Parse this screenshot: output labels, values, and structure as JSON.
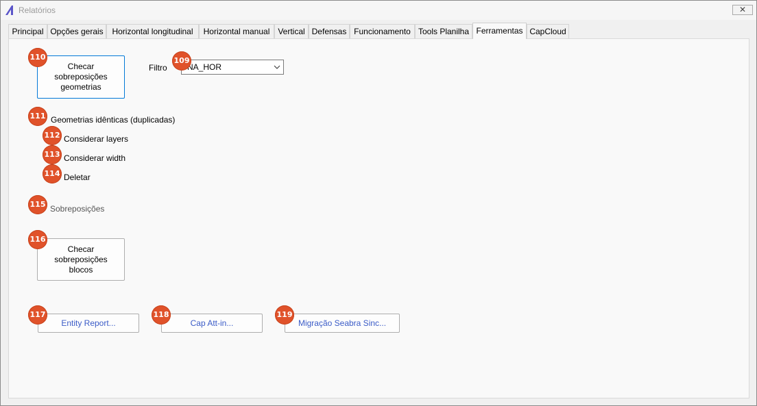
{
  "window": {
    "title": "Relatórios",
    "close_glyph": "✕"
  },
  "tabs": [
    {
      "label": "Principal"
    },
    {
      "label": "Opções gerais"
    },
    {
      "label": "Horizontal longitudinal"
    },
    {
      "label": "Horizontal manual"
    },
    {
      "label": "Vertical"
    },
    {
      "label": "Defensas"
    },
    {
      "label": "Funcionamento"
    },
    {
      "label": "Tools Planilha"
    },
    {
      "label": "Ferramentas",
      "active": true
    },
    {
      "label": "CapCloud"
    }
  ],
  "tools": {
    "check_geometry_button": {
      "label": "Checar sobreposições geometrias",
      "badge": "110"
    },
    "filter": {
      "label": "Filtro",
      "value": "NA_HOR",
      "badge": "109"
    },
    "identical": {
      "label": "Geometrias idênticas (duplicadas)",
      "badge": "111"
    },
    "consider_layers": {
      "label": "Considerar layers",
      "badge": "112"
    },
    "consider_width": {
      "label": "Considerar width",
      "badge": "113"
    },
    "delete": {
      "label": "Deletar",
      "badge": "114"
    },
    "overlaps": {
      "label": "Sobreposições",
      "badge": "115"
    },
    "check_blocks_button": {
      "label": "Checar sobreposições blocos",
      "badge": "116"
    },
    "entity_report_button": {
      "label": "Entity Report...",
      "badge": "117"
    },
    "cap_attin_button": {
      "label": "Cap Att-in...",
      "badge": "118"
    },
    "migration_button": {
      "label": "Migração Seabra Sinc...",
      "badge": "119"
    }
  },
  "colors": {
    "badge": "#e0522a",
    "link_text": "#3a5bc7",
    "focus_border": "#0078d7"
  }
}
